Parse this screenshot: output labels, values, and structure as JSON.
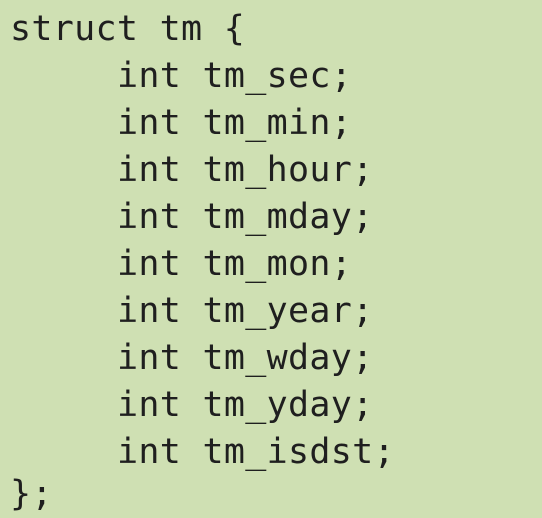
{
  "code": {
    "lines": [
      "struct tm {",
      "int tm_sec;",
      "int tm_min;",
      "int tm_hour;",
      "int tm_mday;",
      "int tm_mon;",
      "int tm_year;",
      "int tm_wday;",
      "int tm_yday;",
      "int tm_isdst;",
      "};"
    ]
  },
  "colors": {
    "background": "#cfe0b3",
    "text": "#1f1f1f"
  }
}
